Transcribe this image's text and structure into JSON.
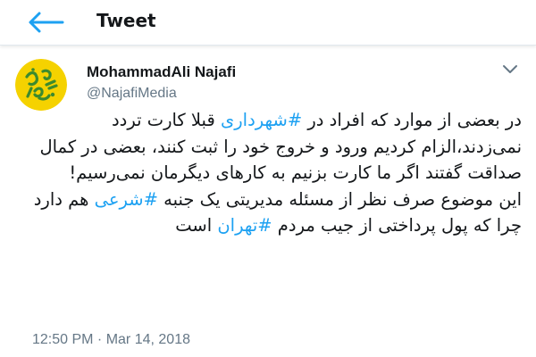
{
  "header": {
    "back_icon": "arrow-left-icon",
    "title": "Tweet",
    "accent_color": "#1da1f2"
  },
  "tweet": {
    "author": {
      "display_name": "MohammadAli Najafi",
      "handle": "@NajafiMedia",
      "avatar_icon": "logo-avatar",
      "avatar_bg": "#f5d200"
    },
    "menu_icon": "chevron-down-icon",
    "body": {
      "line1_a": "در بعضی از موارد که افراد در ",
      "hashtag1": "#شهرداری",
      "line1_b": " قبلا کارت تردد نمی‌زدند،الزام کردیم ورود و خروج خود را ثبت کنند، بعضی در کمال صداقت گفتند اگر ما کارت بزنیم به کارهای دیگرمان نمی‌رسیم!",
      "line2_a": "این موضوع صرف نظر از مسئله مدیریتی یک جنبه ",
      "hashtag2": "#شرعی",
      "line2_b": " هم دارد چرا که پول پرداختی از جیب مردم ",
      "hashtag3": "#تهران",
      "line2_c": " است"
    },
    "timestamp": "12:50 PM · Mar 14, 2018",
    "hashtag_color": "#1da1f2"
  }
}
